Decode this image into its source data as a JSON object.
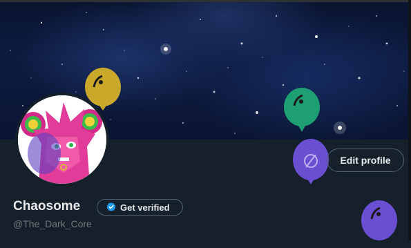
{
  "profile": {
    "display_name": "Chaosome",
    "handle": "@The_Dark_Core"
  },
  "buttons": {
    "edit_profile_label": "Edit profile",
    "get_verified_label": "Get verified"
  },
  "icons": {
    "verified": "verified-badge-icon",
    "balloon_center": "disconnected-icon"
  },
  "colors": {
    "background": "#15202b",
    "text_primary": "#e7e9ea",
    "text_secondary": "#71767b",
    "accent": "#1d9bf0",
    "balloon_gold": "#c9a82a",
    "balloon_green": "#1e9e73",
    "balloon_purple": "#6a4fd2"
  }
}
